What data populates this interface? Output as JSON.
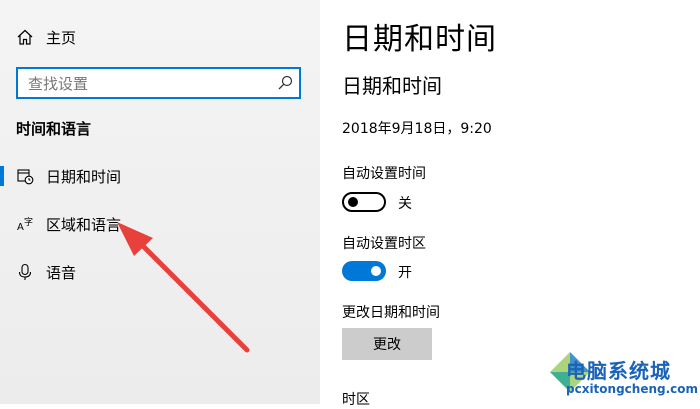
{
  "sidebar": {
    "home_label": "主页",
    "search_placeholder": "查找设置",
    "section_title": "时间和语言",
    "items": [
      {
        "label": "日期和时间",
        "icon": "calendar-clock-icon",
        "active": true
      },
      {
        "label": "区域和语言",
        "icon": "language-icon",
        "active": false
      },
      {
        "label": "语音",
        "icon": "microphone-icon",
        "active": false
      }
    ]
  },
  "main": {
    "page_title": "日期和时间",
    "section_title": "日期和时间",
    "current_datetime": "2018年9月18日，9:20",
    "auto_time": {
      "label": "自动设置时间",
      "state_label": "关",
      "on": false
    },
    "auto_timezone": {
      "label": "自动设置时区",
      "state_label": "开",
      "on": true
    },
    "change_datetime": {
      "label": "更改日期和时间",
      "button_label": "更改"
    },
    "timezone_label": "时区"
  },
  "watermark": {
    "title": "电脑系统城",
    "url": "pcxitongcheng.com"
  },
  "colors": {
    "accent": "#0078d7",
    "annotation_arrow": "#e8403a",
    "watermark": "#1a63b8"
  }
}
